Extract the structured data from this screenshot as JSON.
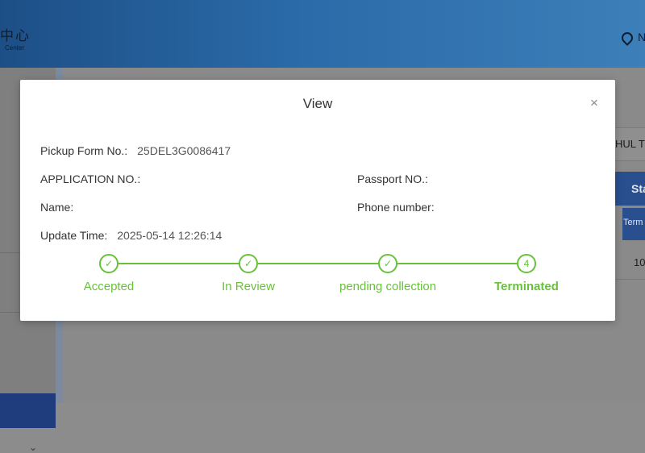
{
  "background": {
    "logo_cn": "中心",
    "logo_en": "Center",
    "location_text": "N",
    "input_text": "HUL T",
    "table_header": "Sta",
    "tag_text": "Term",
    "cell_value": "10"
  },
  "modal": {
    "title": "View",
    "close_icon": "×",
    "fields": {
      "pickup_form_label": "Pickup Form No.:",
      "pickup_form_value": "25DEL3G0086417",
      "application_label": "APPLICATION NO.:",
      "passport_label": "Passport NO.:",
      "name_label": "Name:",
      "phone_label": "Phone number:",
      "update_time_label": "Update Time:",
      "update_time_value": "2025-05-14 12:26:14"
    },
    "steps": [
      {
        "label": "Accepted",
        "icon": "✓"
      },
      {
        "label": "In Review",
        "icon": "✓"
      },
      {
        "label": "pending collection",
        "icon": "✓"
      },
      {
        "label": "Terminated",
        "icon": "4"
      }
    ],
    "accent_color": "#67c23a"
  }
}
